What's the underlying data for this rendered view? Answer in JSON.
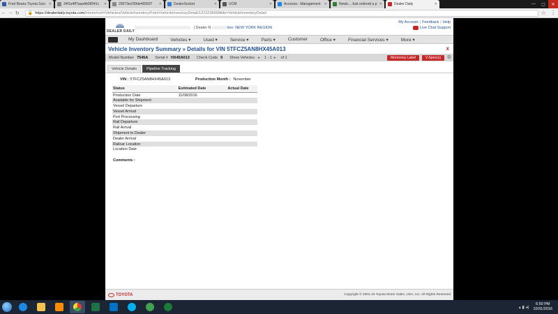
{
  "browser": {
    "tabs": [
      {
        "title": "Fred Beans Toyota Scio",
        "color": "#2a5ca8",
        "active": false
      },
      {
        "title": "34f1a4ff7aaa4b08941c",
        "color": "#888888",
        "active": false
      },
      {
        "title": "20673ecf39de465697",
        "color": "#888888",
        "active": false
      },
      {
        "title": "DealerSocket",
        "color": "#3a7bd5",
        "active": false
      },
      {
        "title": "UCM",
        "color": "#555555",
        "active": false
      },
      {
        "title": "Accessa - Management",
        "color": "#1e88e5",
        "active": false
      },
      {
        "title": "Newb... Just ordered a p",
        "color": "#2e7d32",
        "active": false
      },
      {
        "title": "Dealer Daily",
        "color": "#c62828",
        "active": true
      }
    ],
    "url_host": "https://dealerdaily.toyota.com",
    "url_path": "/Home#url=/Vehicles/VehicleInventory/FetchVehicleInventoryDetail/1223238998title=VehicleInventoryDetail",
    "win_controls": [
      "—",
      "▢",
      "✕"
    ]
  },
  "header": {
    "logo_text": "DEALER DAILY",
    "dealer_text": "| Dealer N",
    "region_text": "tion: NEW YORK REGION",
    "links": [
      "My Account",
      "Feedback",
      "Help"
    ],
    "live_chat": "Live Chat Support"
  },
  "nav": {
    "items": [
      "My Dashboard",
      "Vehicles ▾",
      "Used ▾",
      "Service ▾",
      "Parts ▾",
      "Customer",
      "Office ▾",
      "Financial Services ▾",
      "More ▾"
    ]
  },
  "title": {
    "crumb": "Vehicle Inventory Summary",
    "detail": "» Details for VIN 5TFCZ5AN8HX45A013",
    "close": "x"
  },
  "info": {
    "model_label": "Model Number",
    "model_value": "7545A",
    "serial_label": "Serial #",
    "serial_value": "HX45A013",
    "check_label": "Check Code",
    "check_value": "9",
    "show_label": "Show Vehicles",
    "page_text": "1 - 1",
    "of_text": "of 1",
    "btn_monroney": "Monroney Label",
    "btn_vspec": "V-Spec(s)"
  },
  "subtabs": [
    "Vehicle Details",
    "Pipeline Tracking"
  ],
  "vin_row": {
    "vin_label": "VIN :",
    "vin_value": "5TFCZ5AN8HX45A013",
    "pm_label": "Production Month :",
    "pm_value": "November"
  },
  "pipeline": {
    "headers": [
      "Status",
      "Estimated Date",
      "Actual Date"
    ],
    "rows": [
      {
        "status": "Production Date",
        "est": "11/08/2016",
        "act": ""
      },
      {
        "status": "Available for Shipment",
        "est": "",
        "act": ""
      },
      {
        "status": "Vessel Departure",
        "est": "",
        "act": ""
      },
      {
        "status": "Vessel Arrival",
        "est": "",
        "act": ""
      },
      {
        "status": "Port Processing",
        "est": "",
        "act": ""
      },
      {
        "status": "Rail Departure",
        "est": "",
        "act": ""
      },
      {
        "status": "Rail Arrival",
        "est": "",
        "act": ""
      },
      {
        "status": "Shipment to Dealer",
        "est": "",
        "act": ""
      },
      {
        "status": "Dealer Arrival",
        "est": "",
        "act": ""
      },
      {
        "status": "Railcar Location",
        "est": "",
        "act": ""
      },
      {
        "status": "Location Date",
        "est": "",
        "act": ""
      }
    ],
    "comments_label": "Comments :"
  },
  "footer": {
    "brand": "TOYOTA",
    "copyright": "Copyright © 2001-16 Toyota Motor Sales, USA, Inc. All Rights Reserved"
  },
  "taskbar": {
    "time": "6:50 PM",
    "date": "10/31/2016"
  }
}
